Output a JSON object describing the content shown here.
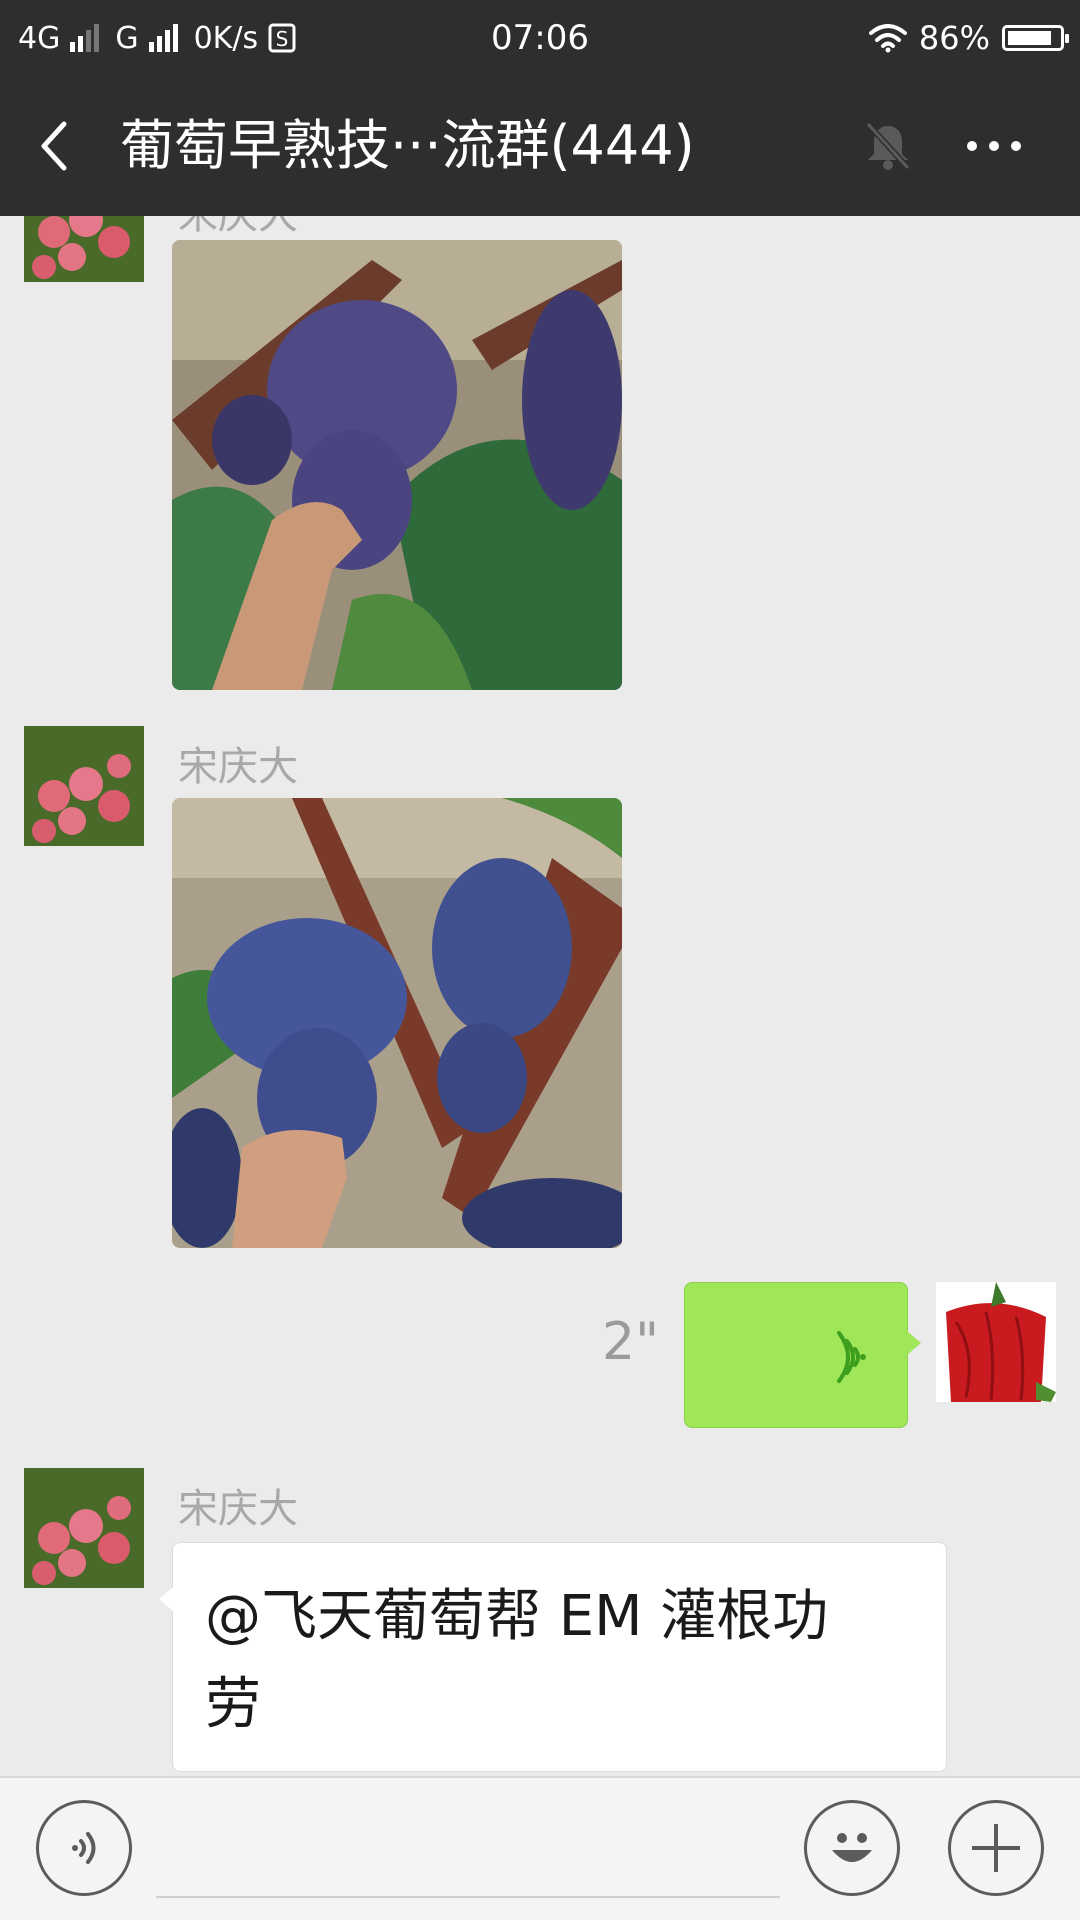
{
  "status_bar": {
    "network_4g": "4G",
    "network_g": "G",
    "speed": "0K/s",
    "sync_icon": "S",
    "time": "07:06",
    "battery": "86%",
    "battery_level": 0.86
  },
  "header": {
    "title": "葡萄早熟技···流群(444)",
    "muted": true
  },
  "messages": [
    {
      "type": "image",
      "direction": "incoming",
      "sender": "宋庆大",
      "content": "photo-grapes-hand"
    },
    {
      "type": "image",
      "direction": "incoming",
      "sender": "宋庆大",
      "content": "photo-grapes-vine"
    },
    {
      "type": "voice",
      "direction": "outgoing",
      "duration": "2\""
    },
    {
      "type": "text",
      "direction": "incoming",
      "sender": "宋庆大",
      "text_line1": "@飞天葡萄帮  EM 灌根功",
      "text_line2": "劳"
    }
  ],
  "input_bar": {
    "icons": [
      "voice-input-icon",
      "emoji-icon",
      "plus-icon"
    ]
  },
  "colors": {
    "bar_bg": "#2e2e2e",
    "chat_bg": "#ebebeb",
    "voice_bubble": "#9fe658",
    "sender_text": "#a8a8a8"
  }
}
